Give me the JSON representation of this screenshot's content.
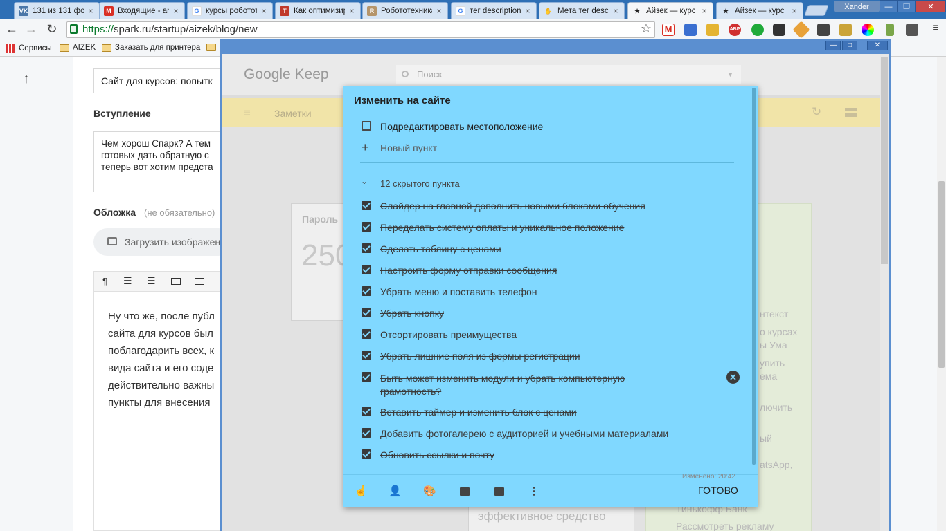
{
  "tabs": [
    {
      "title": "131 из 131 фо",
      "icon": "vk-icon",
      "color": "#4a76a8",
      "glyph": "VK"
    },
    {
      "title": "Входящие - an",
      "icon": "gmail-icon",
      "color": "#d93025",
      "glyph": "M"
    },
    {
      "title": "курсы роботот",
      "icon": "google-icon",
      "color": "#4285f4",
      "glyph": "G"
    },
    {
      "title": "Как оптимизир",
      "icon": "t-icon",
      "color": "#c0392b",
      "glyph": "T"
    },
    {
      "title": "Робототехника",
      "icon": "robot-icon",
      "color": "#b5956b",
      "glyph": "R"
    },
    {
      "title": "тег description",
      "icon": "google-icon",
      "color": "#4285f4",
      "glyph": "G"
    },
    {
      "title": "Мета тег desc",
      "icon": "hand-icon",
      "color": "#e67e22",
      "glyph": "✋"
    },
    {
      "title": "Айзек — курс",
      "icon": "star-icon",
      "color": "#222222",
      "glyph": "★"
    },
    {
      "title": "Айзек — курс",
      "icon": "star-icon",
      "color": "#222222",
      "glyph": "★"
    }
  ],
  "user_name": "Xander",
  "url": {
    "scheme": "https://",
    "host": "spark.ru",
    "path": "/startup/aizek/blog/new"
  },
  "bookmarks": [
    "Сервисы",
    "AIZEK",
    "Заказать для принтера"
  ],
  "blog": {
    "title_value": "Сайт для курсов: попытк",
    "intro_label": "Вступление",
    "intro_lines": [
      "Чем хорош Спарк? А тем",
      "готовых дать обратную с",
      "теперь вот хотим предста"
    ],
    "cover_label": "Обложка",
    "cover_hint": "(не обязательно)",
    "upload_label": "Загрузить изображен",
    "editor_lines": [
      "Ну что же, после публ",
      "сайта для курсов был",
      "поблагодарить всех, к",
      "вида сайта и его соде",
      "действительно важны",
      "пункты для внесения"
    ]
  },
  "keep": {
    "logo": "Google Keep",
    "search_placeholder": "Поиск",
    "section_label": "Заметки",
    "bg_card_title": "Пароль",
    "bg_card_number": "250",
    "bg_snippets": [
      "нтекст",
      "о курсах",
      "ы Ума",
      "упить",
      "ема",
      "лючить",
      "ый",
      "atsApp,",
      "эффективное средство",
      "Тинькофф Банк",
      "Рассмотреть рекламу"
    ],
    "note": {
      "title": "Изменить на сайте",
      "unchecked_item": "Подредактировать местоположение",
      "new_item_placeholder": "Новый пункт",
      "hidden_count_label": "12 скрытого пункта",
      "checked_items": [
        "Слайдер на главной дополнить новыми блоками обучения",
        "Переделать систему оплаты и уникальное положение",
        "Сделать таблицу с ценами",
        "Настроить форму отправки сообщения",
        "Убрать меню и поставить телефон",
        "Убрать кнопку",
        "Отсортировать преимущества",
        "Убрать лишние поля из формы регистрации",
        "Быть может изменить модули и убрать компьютерную грамотность?",
        "Вставить таймер и изменить блок с ценами",
        "Добавить фотогалерею с аудиторией и учебными материалами",
        "Обновить ссылки и почту"
      ],
      "edited_label": "Изменено: 20:42",
      "done_label": "ГОТОВО"
    }
  },
  "colors": {
    "note_bg": "#80d8ff",
    "keep_bar": "#f1e4a8",
    "chrome_frame": "#2e6fb5"
  }
}
